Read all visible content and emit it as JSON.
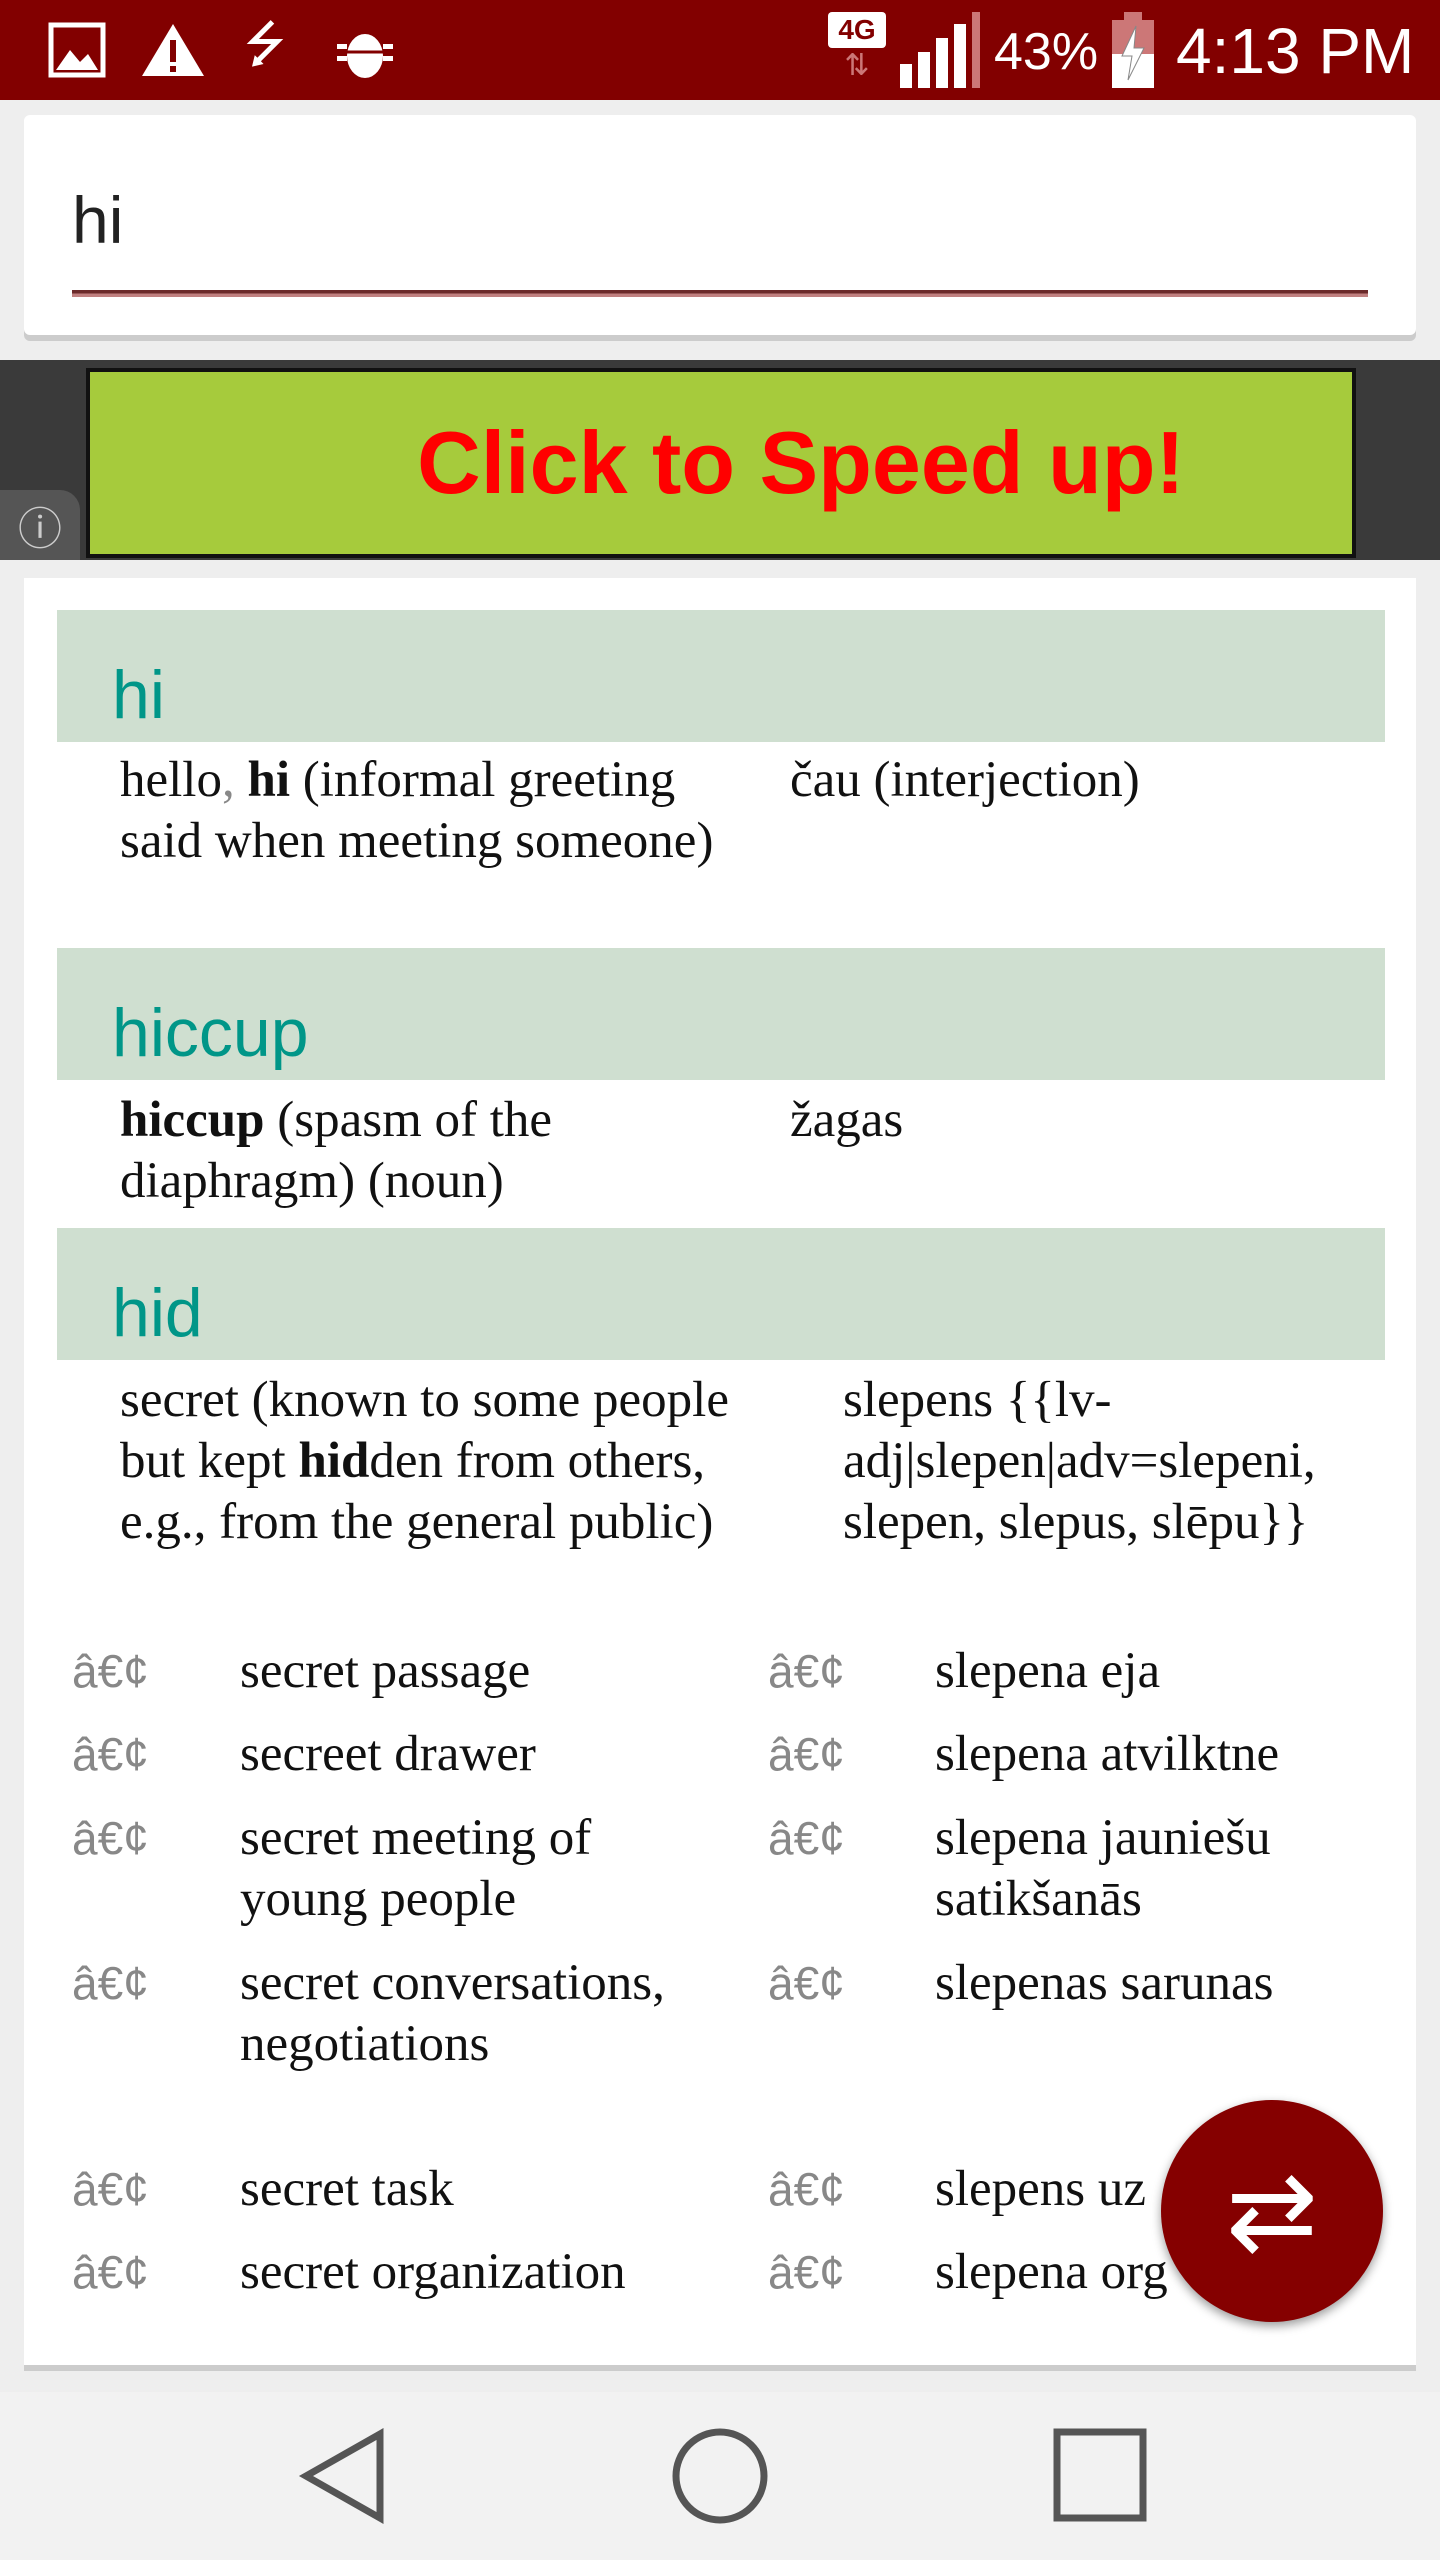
{
  "status_bar": {
    "icons": [
      "image-icon",
      "warning-icon",
      "usb-icon",
      "bug-icon",
      "4g-icon",
      "signal-icon",
      "battery-charging-icon"
    ],
    "network": "4G",
    "battery": "43%",
    "time": "4:13 PM"
  },
  "search": {
    "value": "hi"
  },
  "ad": {
    "label": "Click to Speed up!"
  },
  "entries": [
    {
      "headword": "hi",
      "left": [
        "hello",
        ", ",
        "hi",
        " (informal greeting said when meeting someone)"
      ],
      "right": "čau (interjection)"
    },
    {
      "headword": "hiccup",
      "left": [
        "hiccup",
        " (spasm of the diaphragm) (noun)"
      ],
      "right": "žagas"
    },
    {
      "headword": "hid",
      "left": [
        "secret (known to some people but kept ",
        "hid",
        "den from others, e.g., from the general public)"
      ],
      "right": "slepens {{lv-adj|slepen|adv=slepeni, slepen, slepus, slēpu}}"
    }
  ],
  "bullet": "â€¢",
  "examples": [
    {
      "en": "secret passage",
      "lv": "slepena eja"
    },
    {
      "en": "secreet drawer",
      "lv": "slepena atvilktne"
    },
    {
      "en": "secret meeting of young people",
      "lv": "slepena jauniešu satikšanās"
    },
    {
      "en": "secret conversations, negotiations",
      "lv": "slepenas sarunas"
    },
    {
      "en": "secret task",
      "lv": "slepens uz"
    },
    {
      "en": "secret organization",
      "lv": "slepena org"
    }
  ],
  "fab": {
    "icon": "swap-icon"
  },
  "nav": {
    "icons": [
      "back-icon",
      "home-icon",
      "recents-icon"
    ]
  },
  "colors": {
    "status": "#820000",
    "accent": "#009688",
    "header_bg": "#cfdfd0",
    "fab": "#850000",
    "ad_bg": "#a6cb3c",
    "ad_text": "#ff0000"
  }
}
